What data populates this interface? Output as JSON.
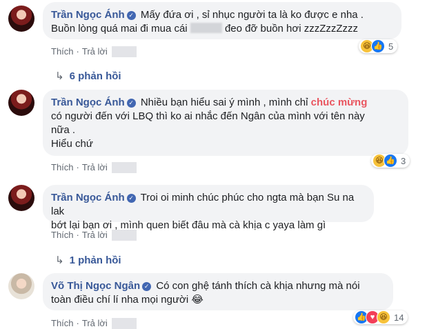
{
  "comments": [
    {
      "name": "Trần Ngọc Ánh",
      "text_lines": [
        "Mấy đứa ơi , sỉ nhục người ta là ko được e nha .",
        "Buồn lòng quá mai đi mua cái",
        "đeo đỡ buồn hơi zzzZzzZzzz"
      ],
      "like": "Thích",
      "reply": "Trả lời",
      "react_count": "5"
    },
    {
      "replies_label": "6 phản hồi"
    },
    {
      "name": "Trần Ngọc Ánh",
      "text_pre": "Nhiều bạn hiểu sai ý mình , mình chỉ",
      "text_highlight": "chúc mừng",
      "text_lines": [
        "có người đến với LBQ thì ko ai nhắc đến Ngân của mình với tên này",
        "nữa .",
        "Hiểu chứ"
      ],
      "like": "Thích",
      "reply": "Trả lời",
      "react_count": "3"
    },
    {
      "name": "Trần Ngọc Ánh",
      "text_lines": [
        "Troi oi minh chúc phúc cho ngta mà bạn Su na lak",
        "bớt lại bạn ơi , mình quen biết đâu mà cà khịa c yaya làm gì"
      ],
      "like": "Thích",
      "reply": "Trả lời"
    },
    {
      "replies_label": "1 phản hồi"
    },
    {
      "name": "Võ Thị Ngọc Ngân",
      "text_lines": [
        "Có con ghệ tánh thích cà khịa nhưng mà nói",
        "toàn điều chí lí nha mọi người 😂"
      ],
      "like": "Thích",
      "reply": "Trả lời",
      "react_count": "14"
    }
  ],
  "colors": {
    "name": "#385898",
    "highlight": "#e9555f",
    "bubble": "#f2f3f5"
  },
  "icons": [
    "verified-badge-icon",
    "haha-reaction-icon",
    "like-reaction-icon",
    "love-reaction-icon",
    "reply-arrow-icon"
  ]
}
